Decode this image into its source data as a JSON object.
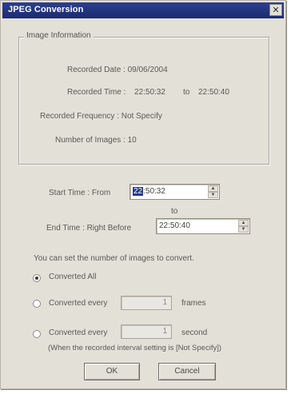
{
  "window": {
    "title": "JPEG Conversion",
    "close_glyph": "✕"
  },
  "image_information": {
    "legend": "Image Information",
    "recorded_date": "Recorded Date : 09/06/2004",
    "recorded_time_label": "Recorded Time :",
    "recorded_time_start": "22:50:32",
    "recorded_time_to": "to",
    "recorded_time_end": "22:50:40",
    "recorded_frequency": "Recorded Frequency : Not Specify",
    "number_of_images": "Number of Images : 10"
  },
  "time_range": {
    "start_label": "Start Time :  From",
    "start_value_highlight": "22",
    "start_value_rest": ":50:32",
    "connector": "to",
    "end_label": "End Time :  Right Before",
    "end_value": "22:50:40"
  },
  "conversion": {
    "instruction": "You can set the number of images to convert.",
    "options": [
      {
        "label": "Converted All",
        "selected": true
      },
      {
        "label": "Converted every",
        "value": "1",
        "unit": "frames",
        "selected": false
      },
      {
        "label": "Converted every",
        "value": "1",
        "unit": "second",
        "selected": false
      }
    ],
    "note": "(When the recorded interval setting is [Not Specify])"
  },
  "buttons": {
    "ok": "OK",
    "cancel": "Cancel"
  },
  "icons": {
    "spin_up": "▲",
    "spin_down": "▼"
  }
}
